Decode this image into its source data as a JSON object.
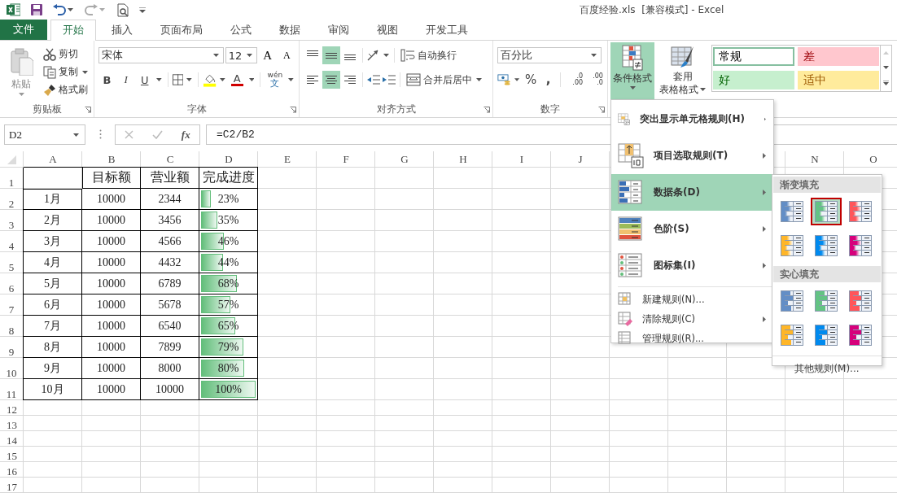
{
  "window": {
    "title": "百度经验.xls  [兼容模式] - Excel"
  },
  "ribbon_tabs": [
    {
      "label": "文件",
      "kind": "file",
      "selected": false
    },
    {
      "label": "开始",
      "kind": "tab",
      "selected": true
    },
    {
      "label": "插入",
      "kind": "tab",
      "selected": false
    },
    {
      "label": "页面布局",
      "kind": "tab",
      "selected": false
    },
    {
      "label": "公式",
      "kind": "tab",
      "selected": false
    },
    {
      "label": "数据",
      "kind": "tab",
      "selected": false
    },
    {
      "label": "审阅",
      "kind": "tab",
      "selected": false
    },
    {
      "label": "视图",
      "kind": "tab",
      "selected": false
    },
    {
      "label": "开发工具",
      "kind": "tab",
      "selected": false
    }
  ],
  "clipboard": {
    "paste": "粘贴",
    "cut": "剪切",
    "copy": "复制",
    "format_painter": "格式刷",
    "group_label": "剪贴板"
  },
  "font": {
    "font_name": "宋体",
    "font_size": "12",
    "grow_font": "A",
    "shrink_font": "A",
    "bold": "B",
    "italic": "I",
    "underline": "U",
    "font_color": "A",
    "phonetic_top": "wén",
    "phonetic_bottom": "文",
    "group_label": "字体"
  },
  "alignment": {
    "vertical": [
      {
        "selected": false
      },
      {
        "selected": true
      },
      {
        "selected": false
      }
    ],
    "horizontal": [
      {
        "selected": false
      },
      {
        "selected": true
      },
      {
        "selected": false
      }
    ],
    "wrap_text": "自动换行",
    "merge_center": "合并后居中",
    "group_label": "对齐方式"
  },
  "number": {
    "format": "百分比",
    "percent": "%",
    "comma": ",",
    "increase_decimal": [
      ".0",
      ".00"
    ],
    "decrease_decimal": [
      ".00",
      ".0"
    ],
    "group_label": "数字"
  },
  "styles": {
    "conditional_formatting": {
      "label": "条件格式",
      "selected": true
    },
    "format_as_table": [
      "套用",
      "表格格式"
    ],
    "cell_styles": [
      {
        "label": "常规",
        "kind": "normal",
        "selected": true
      },
      {
        "label": "差",
        "kind": "bad",
        "selected": false
      },
      {
        "label": "好",
        "kind": "good",
        "selected": false
      },
      {
        "label": "适中",
        "kind": "neutral",
        "selected": false
      }
    ]
  },
  "formula_bar": {
    "name_box": "D2",
    "fx": "fx",
    "formula": "=C2/B2"
  },
  "sheet": {
    "columns_left": [
      "A",
      "B",
      "C",
      "D",
      "E",
      "F",
      "G",
      "H",
      "I",
      "J"
    ],
    "columns_right": [
      "N",
      "O"
    ],
    "row_numbers": [
      "1",
      "2",
      "3",
      "4",
      "5",
      "6",
      "7",
      "8",
      "9",
      "10",
      "11",
      "12",
      "13",
      "14",
      "15",
      "16",
      "17"
    ],
    "table": {
      "columns": [
        "目标额",
        "营业额",
        "完成进度"
      ],
      "rows": [
        {
          "month": "1月",
          "target": "10000",
          "revenue": "2344",
          "progress": "23%",
          "level": 0.23
        },
        {
          "month": "2月",
          "target": "10000",
          "revenue": "3456",
          "progress": "35%",
          "level": 0.35
        },
        {
          "month": "3月",
          "target": "10000",
          "revenue": "4566",
          "progress": "46%",
          "level": 0.46
        },
        {
          "month": "4月",
          "target": "10000",
          "revenue": "4432",
          "progress": "44%",
          "level": 0.44
        },
        {
          "month": "5月",
          "target": "10000",
          "revenue": "6789",
          "progress": "68%",
          "level": 0.68
        },
        {
          "month": "6月",
          "target": "10000",
          "revenue": "5678",
          "progress": "57%",
          "level": 0.57
        },
        {
          "month": "7月",
          "target": "10000",
          "revenue": "6540",
          "progress": "65%",
          "level": 0.65
        },
        {
          "month": "8月",
          "target": "10000",
          "revenue": "7899",
          "progress": "79%",
          "level": 0.79
        },
        {
          "month": "9月",
          "target": "10000",
          "revenue": "8000",
          "progress": "80%",
          "level": 0.8
        },
        {
          "month": "10月",
          "target": "10000",
          "revenue": "10000",
          "progress": "100%",
          "level": 1
        }
      ]
    }
  },
  "conditional_menu": {
    "items": [
      {
        "label": "突出显示单元格规则(H)",
        "kind": "highlight",
        "submenu": true,
        "selected": false
      },
      {
        "label": "项目选取规则(T)",
        "kind": "top-bottom",
        "submenu": true,
        "selected": false
      },
      {
        "label": "数据条(D)",
        "kind": "data-bars",
        "submenu": true,
        "selected": true
      },
      {
        "label": "色阶(S)",
        "kind": "color-scales",
        "submenu": true,
        "selected": false
      },
      {
        "label": "图标集(I)",
        "kind": "icon-sets",
        "submenu": true,
        "selected": false
      },
      {
        "label": "新建规则(N)...",
        "kind": "new-rule",
        "submenu": false,
        "selected": false
      },
      {
        "label": "清除规则(C)",
        "kind": "clear-rules",
        "submenu": true,
        "selected": false
      },
      {
        "label": "管理规则(R)...",
        "kind": "manage-rules",
        "submenu": false,
        "selected": false
      }
    ]
  },
  "data_bar_menu": {
    "sections": [
      {
        "title": "渐变填充",
        "kind": "gradient",
        "swatches": [
          {
            "color": "#638ec6",
            "selected": false
          },
          {
            "color": "#63c384",
            "selected": true
          },
          {
            "color": "#ff555a",
            "selected": false
          },
          {
            "color": "#ffb628",
            "selected": false
          },
          {
            "color": "#008aef",
            "selected": false
          },
          {
            "color": "#d6007b",
            "selected": false
          }
        ]
      },
      {
        "title": "实心填充",
        "kind": "solid",
        "swatches": [
          {
            "color": "#638ec6",
            "selected": false
          },
          {
            "color": "#63c384",
            "selected": false
          },
          {
            "color": "#ff555a",
            "selected": false
          },
          {
            "color": "#ffb628",
            "selected": false
          },
          {
            "color": "#008aef",
            "selected": false
          },
          {
            "color": "#d6007b",
            "selected": false
          }
        ]
      }
    ],
    "more_rules": "其他规则(M)..."
  }
}
